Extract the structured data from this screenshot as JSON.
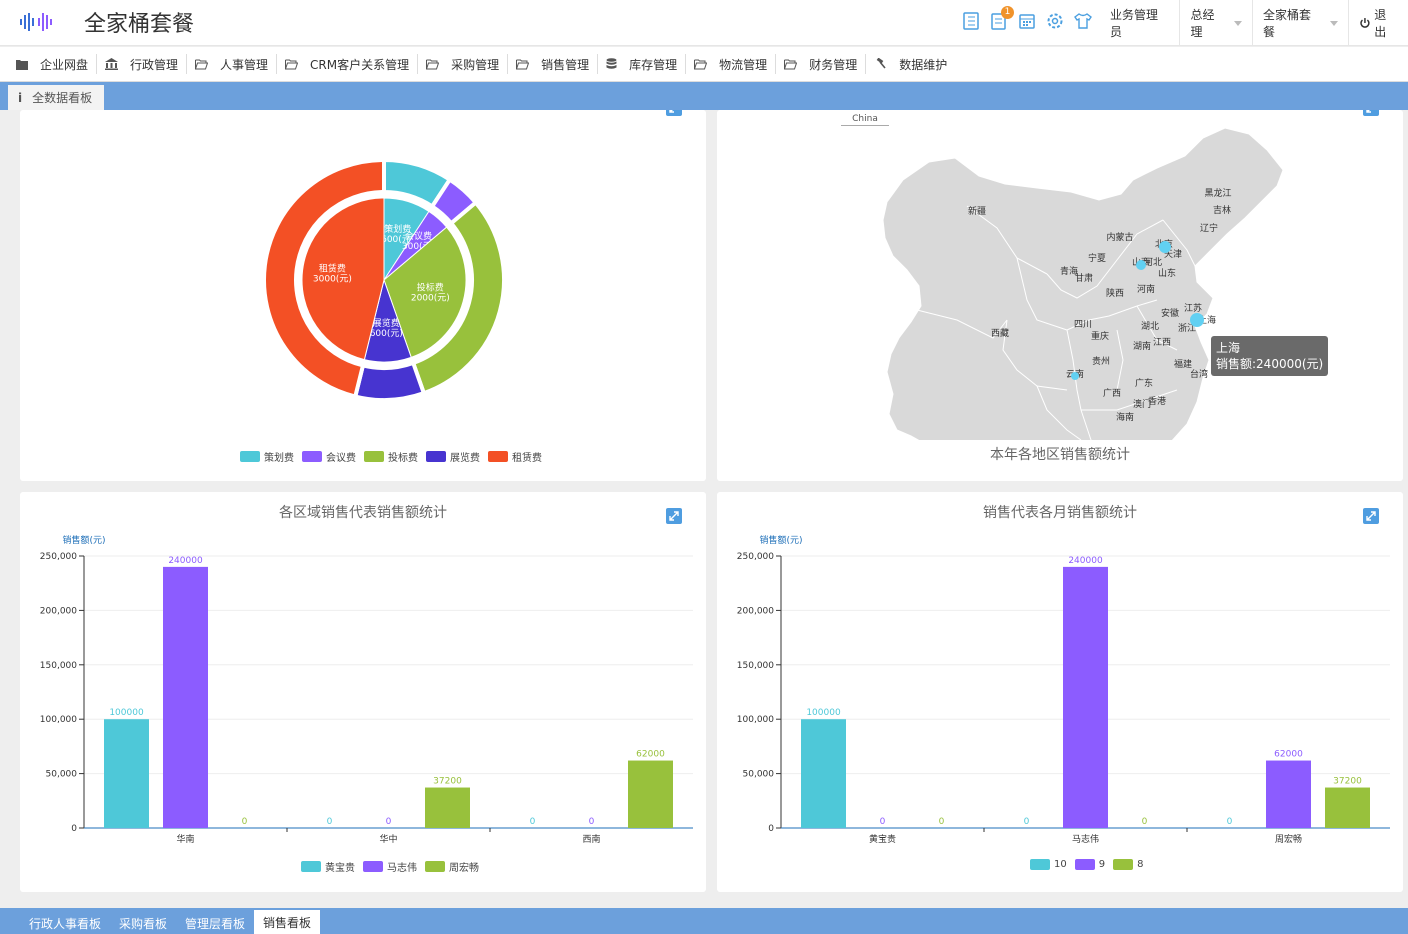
{
  "app": {
    "title": "全家桶套餐"
  },
  "header": {
    "user_role": "业务管理员",
    "user_position": "总经理",
    "package": "全家桶套餐",
    "logout": "退出",
    "notification_count": "1"
  },
  "nav": [
    {
      "label": "企业网盘",
      "icon": "folder-solid-icon"
    },
    {
      "label": "行政管理",
      "icon": "bank-icon"
    },
    {
      "label": "人事管理",
      "icon": "folder-open-icon"
    },
    {
      "label": "CRM客户关系管理",
      "icon": "folder-open-icon"
    },
    {
      "label": "采购管理",
      "icon": "folder-open-icon"
    },
    {
      "label": "销售管理",
      "icon": "folder-open-icon"
    },
    {
      "label": "库存管理",
      "icon": "database-icon"
    },
    {
      "label": "物流管理",
      "icon": "folder-open-icon"
    },
    {
      "label": "财务管理",
      "icon": "folder-open-icon"
    },
    {
      "label": "数据维护",
      "icon": "gavel-icon"
    }
  ],
  "tab": {
    "label": "全数据看板",
    "icon_text": "i"
  },
  "bottom_tabs": [
    {
      "label": "行政人事看板",
      "active": false
    },
    {
      "label": "采购看板",
      "active": false
    },
    {
      "label": "管理层看板",
      "active": false
    },
    {
      "label": "销售看板",
      "active": true
    }
  ],
  "colors": {
    "cyan": "#4ec8d8",
    "purple": "#8c5cff",
    "green": "#98c13c",
    "indigo": "#4734d0",
    "red": "#f35025",
    "accent": "#6ca0dc"
  },
  "map": {
    "subtitle": "China",
    "title": "本年各地区销售额统计",
    "tooltip_region": "上海",
    "tooltip_value": "销售额:240000(元)",
    "provinces": [
      "新疆",
      "西藏",
      "内蒙古",
      "黑龙江",
      "吉林",
      "辽宁",
      "北京",
      "天津",
      "河北",
      "山西",
      "山东",
      "宁夏",
      "青海",
      "甘肃",
      "陕西",
      "河南",
      "江苏",
      "安徽",
      "上海",
      "湖北",
      "浙江",
      "四川",
      "重庆",
      "湖南",
      "江西",
      "贵州",
      "福建",
      "台湾",
      "云南",
      "广东",
      "广西",
      "澳门",
      "香港",
      "海南"
    ]
  },
  "chart_data": [
    {
      "type": "pie",
      "title": "",
      "legend": [
        "策划费",
        "会议费",
        "投标费",
        "展览费",
        "租赁费"
      ],
      "inner": [
        {
          "name": "策划费",
          "value": 600,
          "label": "策划费\n600(元)"
        },
        {
          "name": "会议费",
          "value": 300,
          "label": "会议费\n300(元)"
        },
        {
          "name": "投标费",
          "value": 2000,
          "label": "投标费\n2000(元)"
        },
        {
          "name": "展览费",
          "value": 600,
          "label": "展览费\n600(元)"
        },
        {
          "name": "租赁费",
          "value": 3000,
          "label": "租赁费\n3000(元)"
        }
      ]
    },
    {
      "type": "bar",
      "title": "各区域销售代表销售额统计",
      "ylabel": "销售额(元)",
      "ylim": [
        0,
        250000
      ],
      "yticks": [
        "0",
        "50,000",
        "100,000",
        "150,000",
        "200,000",
        "250,000"
      ],
      "categories": [
        "华南",
        "华中",
        "西南"
      ],
      "series": [
        {
          "name": "黄宝贵",
          "values": [
            100000,
            0,
            0
          ]
        },
        {
          "name": "马志伟",
          "values": [
            240000,
            0,
            0
          ]
        },
        {
          "name": "周宏畅",
          "values": [
            0,
            37200,
            62000
          ]
        }
      ]
    },
    {
      "type": "bar",
      "title": "销售代表各月销售额统计",
      "ylabel": "销售额(元)",
      "ylim": [
        0,
        250000
      ],
      "yticks": [
        "0",
        "50,000",
        "100,000",
        "150,000",
        "200,000",
        "250,000"
      ],
      "categories": [
        "黄宝贵",
        "马志伟",
        "周宏畅"
      ],
      "series": [
        {
          "name": "10",
          "values": [
            100000,
            0,
            0
          ]
        },
        {
          "name": "9",
          "values": [
            0,
            240000,
            62000
          ]
        },
        {
          "name": "8",
          "values": [
            0,
            0,
            37200
          ]
        }
      ]
    }
  ]
}
